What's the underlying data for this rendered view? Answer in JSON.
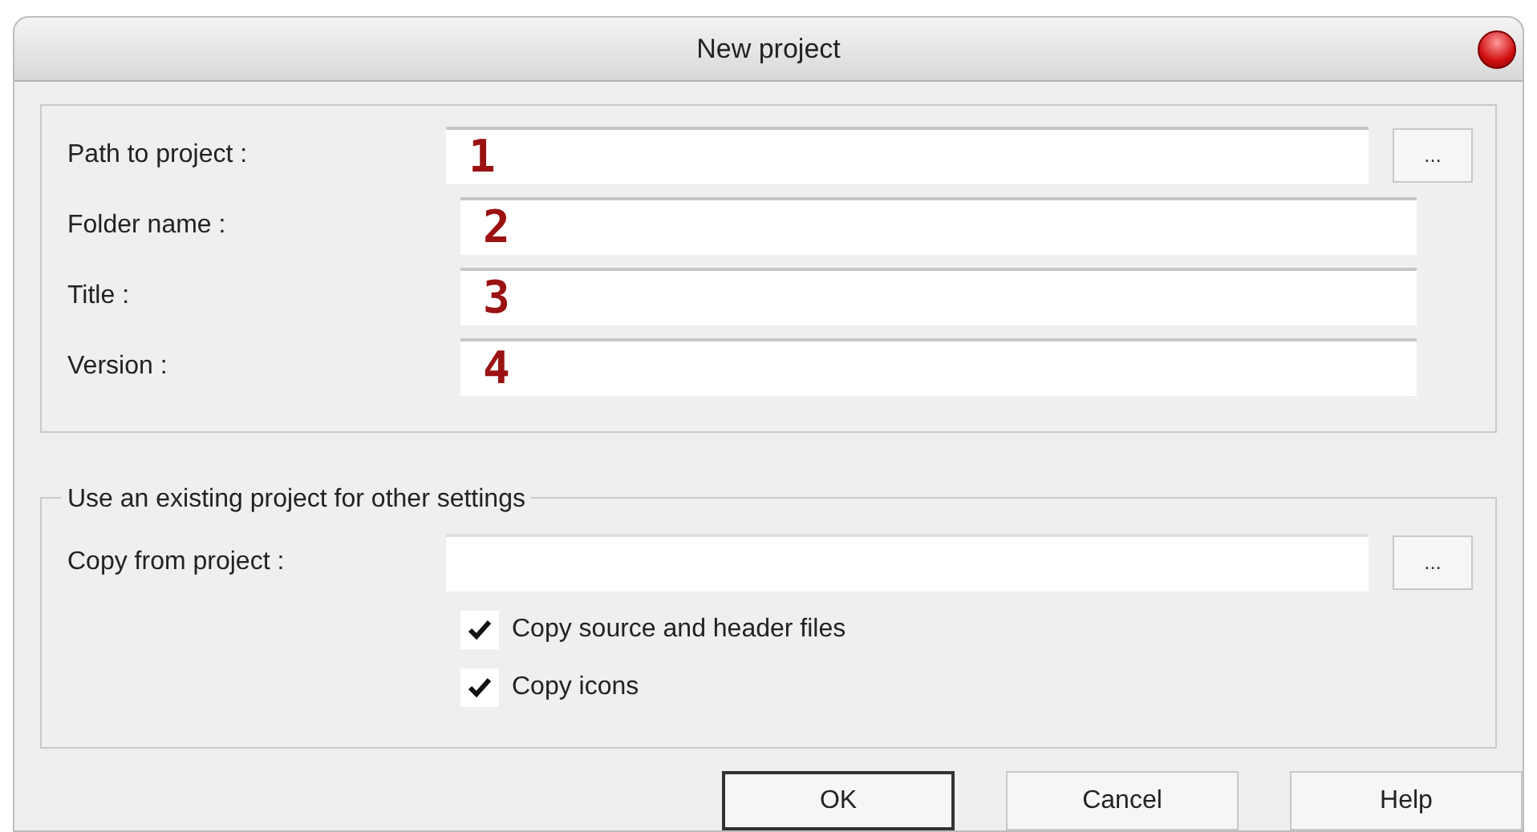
{
  "window": {
    "title": "New project"
  },
  "fields": [
    {
      "label": "Path to project :",
      "value": "1",
      "browse": "..."
    },
    {
      "label": "Folder name :",
      "value": "2"
    },
    {
      "label": "Title :",
      "value": "3"
    },
    {
      "label": "Version :",
      "value": "4"
    }
  ],
  "copy_group": {
    "legend": "Use an existing project for other settings",
    "label": "Copy from project :",
    "browse": "...",
    "options": [
      {
        "label": "Copy source and header files",
        "checked": true
      },
      {
        "label": "Copy icons",
        "checked": true
      }
    ]
  },
  "buttons": [
    {
      "label": "OK",
      "default": true
    },
    {
      "label": "Cancel",
      "default": false
    },
    {
      "label": "Help",
      "default": false
    }
  ]
}
